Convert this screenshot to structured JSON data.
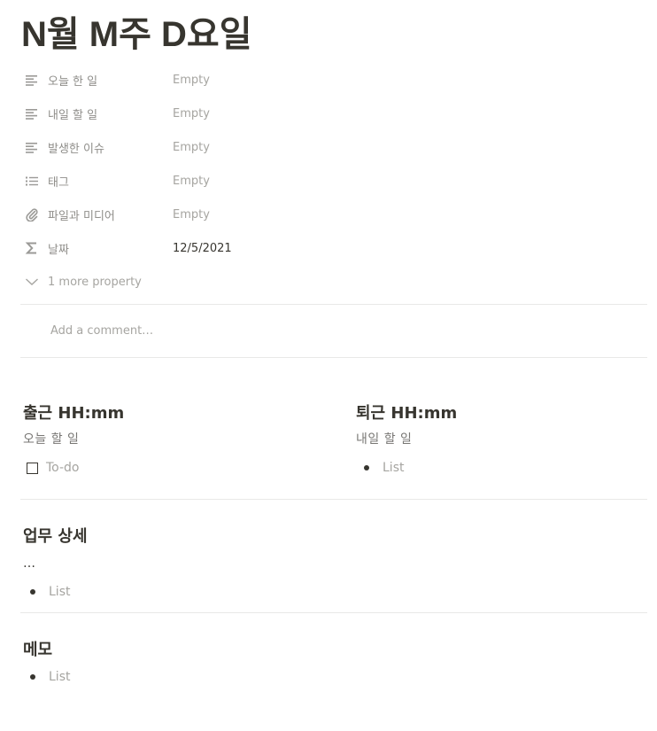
{
  "page": {
    "title": "N월 M주 D요일"
  },
  "properties": [
    {
      "icon": "text-lines-icon",
      "label": "오늘 한 일",
      "value": "Empty"
    },
    {
      "icon": "text-lines-icon",
      "label": "내일 할 일",
      "value": "Empty"
    },
    {
      "icon": "text-lines-icon",
      "label": "발생한 이슈",
      "value": "Empty"
    },
    {
      "icon": "list-icon",
      "label": "태그",
      "value": "Empty"
    },
    {
      "icon": "paperclip-icon",
      "label": "파일과 미디어",
      "value": "Empty"
    },
    {
      "icon": "sigma-icon",
      "label": "날짜",
      "value": "12/5/2021"
    }
  ],
  "more_properties": {
    "icon": "chevron-down-icon",
    "label": "1 more property"
  },
  "comment": {
    "placeholder": "Add a comment…"
  },
  "content": {
    "left": {
      "heading": "출근 HH:mm",
      "subheading": "오늘 할 일",
      "todo_placeholder": "To-do"
    },
    "right": {
      "heading": "퇴근 HH:mm",
      "subheading": "내일 할 일",
      "list_placeholder": "List"
    },
    "details": {
      "heading": "업무 상세",
      "text": "…",
      "list_placeholder": "List"
    },
    "memo": {
      "heading": "메모",
      "list_placeholder": "List"
    }
  }
}
